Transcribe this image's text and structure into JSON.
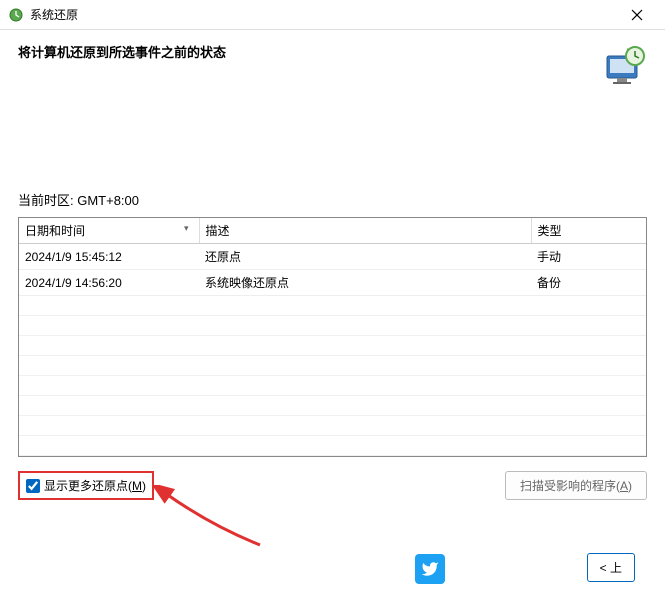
{
  "titlebar": {
    "title": "系统还原"
  },
  "subtitle": "将计算机还原到所选事件之前的状态",
  "timezone_label": "当前时区: GMT+8:00",
  "table": {
    "headers": {
      "date": "日期和时间",
      "desc": "描述",
      "type": "类型"
    },
    "rows": [
      {
        "date": "2024/1/9 15:45:12",
        "desc": "还原点",
        "type": "手动"
      },
      {
        "date": "2024/1/9 14:56:20",
        "desc": "系统映像还原点",
        "type": "备份"
      }
    ]
  },
  "show_more": {
    "prefix": "显示更多还原点(",
    "mnemonic": "M",
    "suffix": ")",
    "checked": true
  },
  "scan_btn": {
    "prefix": "扫描受影响的程序(",
    "mnemonic": "A",
    "suffix": ")"
  },
  "nav": {
    "back": "< 上"
  }
}
